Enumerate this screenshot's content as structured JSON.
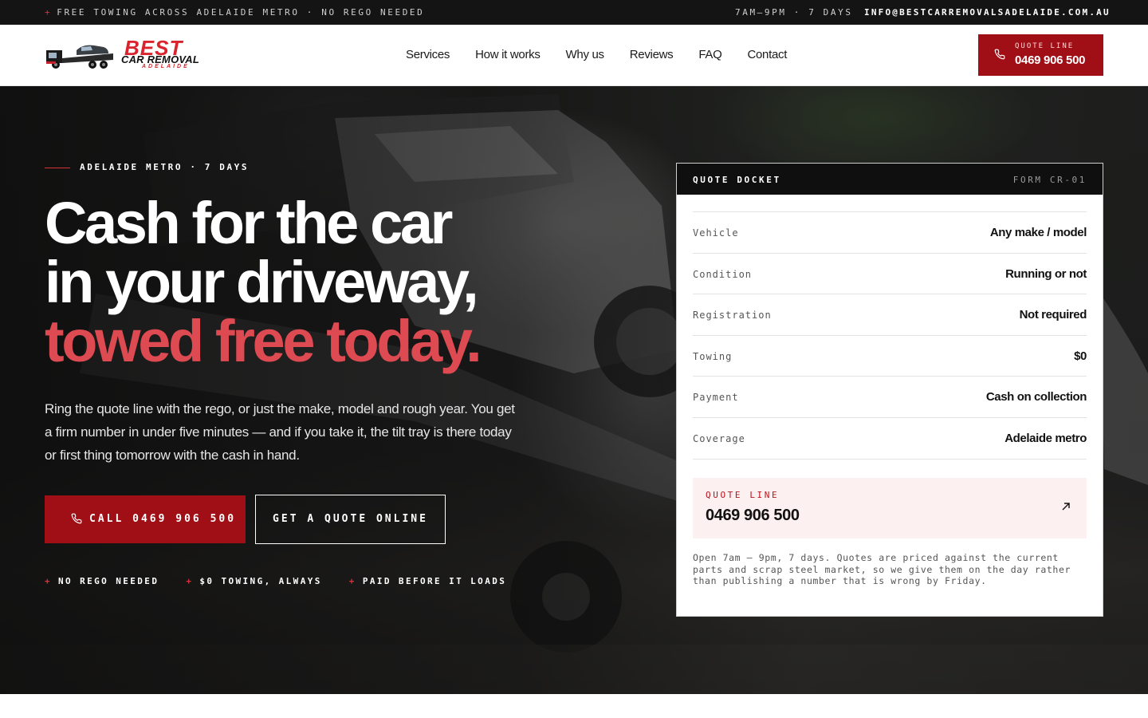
{
  "topbar": {
    "plus": "+",
    "announcement": "FREE TOWING ACROSS ADELAIDE METRO · NO REGO NEEDED",
    "hours": "7AM–9PM · 7 DAYS",
    "email": "INFO@BESTCARREMOVALSADELAIDE.COM.AU"
  },
  "logo": {
    "best": "BEST",
    "car_removal": "CAR REMOVAL",
    "adelaide": "ADELAIDE"
  },
  "nav": {
    "items": [
      "Services",
      "How it works",
      "Why us",
      "Reviews",
      "FAQ",
      "Contact"
    ]
  },
  "header_quote": {
    "label": "QUOTE LINE",
    "number": "0469 906 500"
  },
  "hero": {
    "eyebrow": "ADELAIDE METRO · 7 DAYS",
    "headline_1": "Cash for the car",
    "headline_2": "in your driveway,",
    "headline_3": "towed free today.",
    "lead": "Ring the quote line with the rego, or just the make, model and rough year. You get a firm number in under five minutes — and if you take it, the tilt tray is there today or first thing tomorrow with the cash in hand.",
    "call_button": "CALL 0469 906 500",
    "quote_button": "GET A QUOTE ONLINE",
    "perk_plus": "+",
    "perks": [
      "NO REGO NEEDED",
      "$0 TOWING, ALWAYS",
      "PAID BEFORE IT LOADS"
    ]
  },
  "docket": {
    "title": "QUOTE DOCKET",
    "form": "FORM CR-01",
    "rows": [
      {
        "key": "Vehicle",
        "value": "Any make / model"
      },
      {
        "key": "Condition",
        "value": "Running or not"
      },
      {
        "key": "Registration",
        "value": "Not required"
      },
      {
        "key": "Towing",
        "value": "$0"
      },
      {
        "key": "Payment",
        "value": "Cash on collection"
      },
      {
        "key": "Coverage",
        "value": "Adelaide metro"
      }
    ],
    "quote_line_label": "QUOTE LINE",
    "quote_line_number": "0469 906 500",
    "note": "Open 7am – 9pm, 7 days. Quotes are priced against the current parts and scrap steel market, so we give them on the day rather than publishing a number that is wrong by Friday."
  },
  "colors": {
    "brand_red": "#a00f16",
    "accent_red": "#de4a51",
    "dark": "#141414"
  },
  "icons": [
    "phone-icon",
    "arrow-up-right-icon",
    "tow-truck-icon"
  ]
}
